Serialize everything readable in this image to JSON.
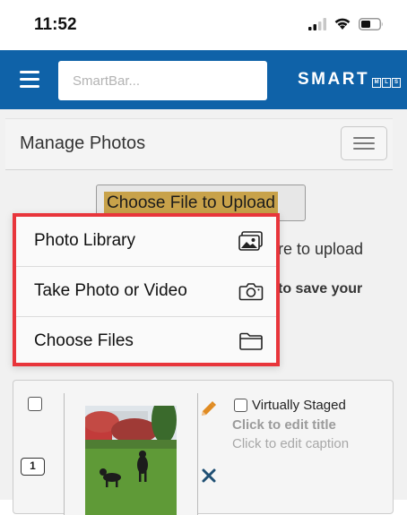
{
  "status_bar": {
    "time": "11:52",
    "icons": [
      "cellular-signal-icon",
      "wifi-icon",
      "battery-icon"
    ]
  },
  "header": {
    "search_placeholder": "SmartBar...",
    "brand": "SMART",
    "brand_suffix_letters": [
      "M",
      "L",
      "S"
    ],
    "background_color": "#0f62a8"
  },
  "panel": {
    "title": "Manage Photos"
  },
  "upload": {
    "choose_file_label": "Choose File to Upload"
  },
  "background_text": {
    "line_1": "re to upload",
    "line_2": "to save your"
  },
  "popover": {
    "border_color": "#e8353b",
    "items": [
      {
        "label": "Photo Library",
        "icon": "photo-library-icon"
      },
      {
        "label": "Take Photo or Video",
        "icon": "camera-icon"
      },
      {
        "label": "Choose Files",
        "icon": "folder-icon"
      }
    ]
  },
  "photo_card": {
    "order": "1",
    "virtually_staged_label": "Virtually Staged",
    "edit_title_text": "Click to edit title",
    "edit_caption_text": "Click to edit caption",
    "icons": [
      "pencil-icon",
      "delete-x-icon"
    ]
  }
}
